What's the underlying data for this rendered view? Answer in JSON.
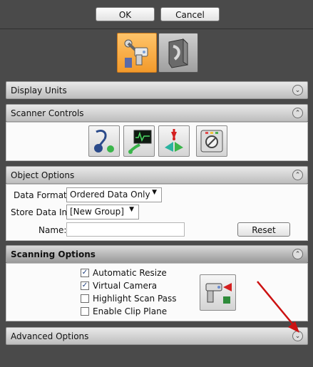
{
  "dialog": {
    "ok_label": "OK",
    "cancel_label": "Cancel"
  },
  "modes": [
    {
      "name": "scanner-arm-mode",
      "active": true
    },
    {
      "name": "surface-mode",
      "active": false
    }
  ],
  "sections": {
    "display_units": {
      "label": "Display Units",
      "state": "collapsed"
    },
    "scanner_controls": {
      "label": "Scanner Controls",
      "state": "expanded",
      "icons": [
        "arm-probe-icon",
        "signal-scanner-icon",
        "laser-pointer-icon",
        "settings-panel-icon"
      ]
    },
    "object_options": {
      "label": "Object Options",
      "state": "expanded",
      "data_format_label": "Data Format:",
      "data_format_value": "Ordered Data Only",
      "store_data_label": "Store Data In:",
      "store_data_value": "[New Group]",
      "name_label": "Name:",
      "name_value": "",
      "reset_label": "Reset"
    },
    "scanning_options": {
      "label": "Scanning Options",
      "state": "expanded",
      "checks": [
        {
          "label": "Automatic Resize",
          "checked": true
        },
        {
          "label": "Virtual Camera",
          "checked": true
        },
        {
          "label": "Highlight Scan Pass",
          "checked": false
        },
        {
          "label": "Enable Clip Plane",
          "checked": false
        }
      ]
    },
    "advanced_options": {
      "label": "Advanced Options",
      "state": "collapsed"
    }
  },
  "colors": {
    "background": "#4a4a4a",
    "active_mode": "#f29a2b",
    "annotation_arrow": "#cc1111"
  }
}
